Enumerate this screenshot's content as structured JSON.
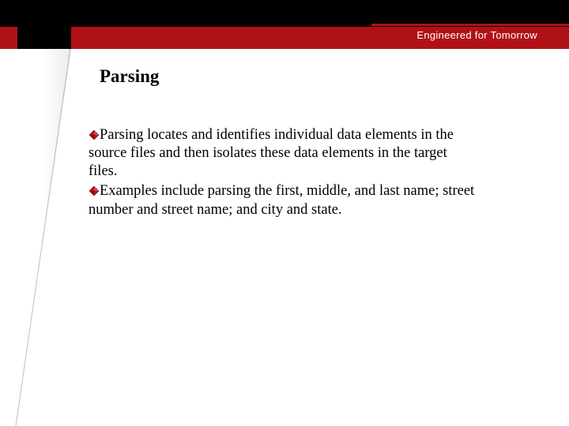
{
  "header": {
    "tagline": "Engineered for Tomorrow"
  },
  "title": "Parsing",
  "bullets": [
    "Parsing locates and identifies individual data elements in the source files and then isolates these data elements in the target files.",
    "Examples include parsing the first, middle, and last name; street number and street name; and city and state."
  ],
  "colors": {
    "brand_red": "#b01116",
    "wedge_brown": "#b8742d",
    "bullet_diamond": "#b01116"
  }
}
